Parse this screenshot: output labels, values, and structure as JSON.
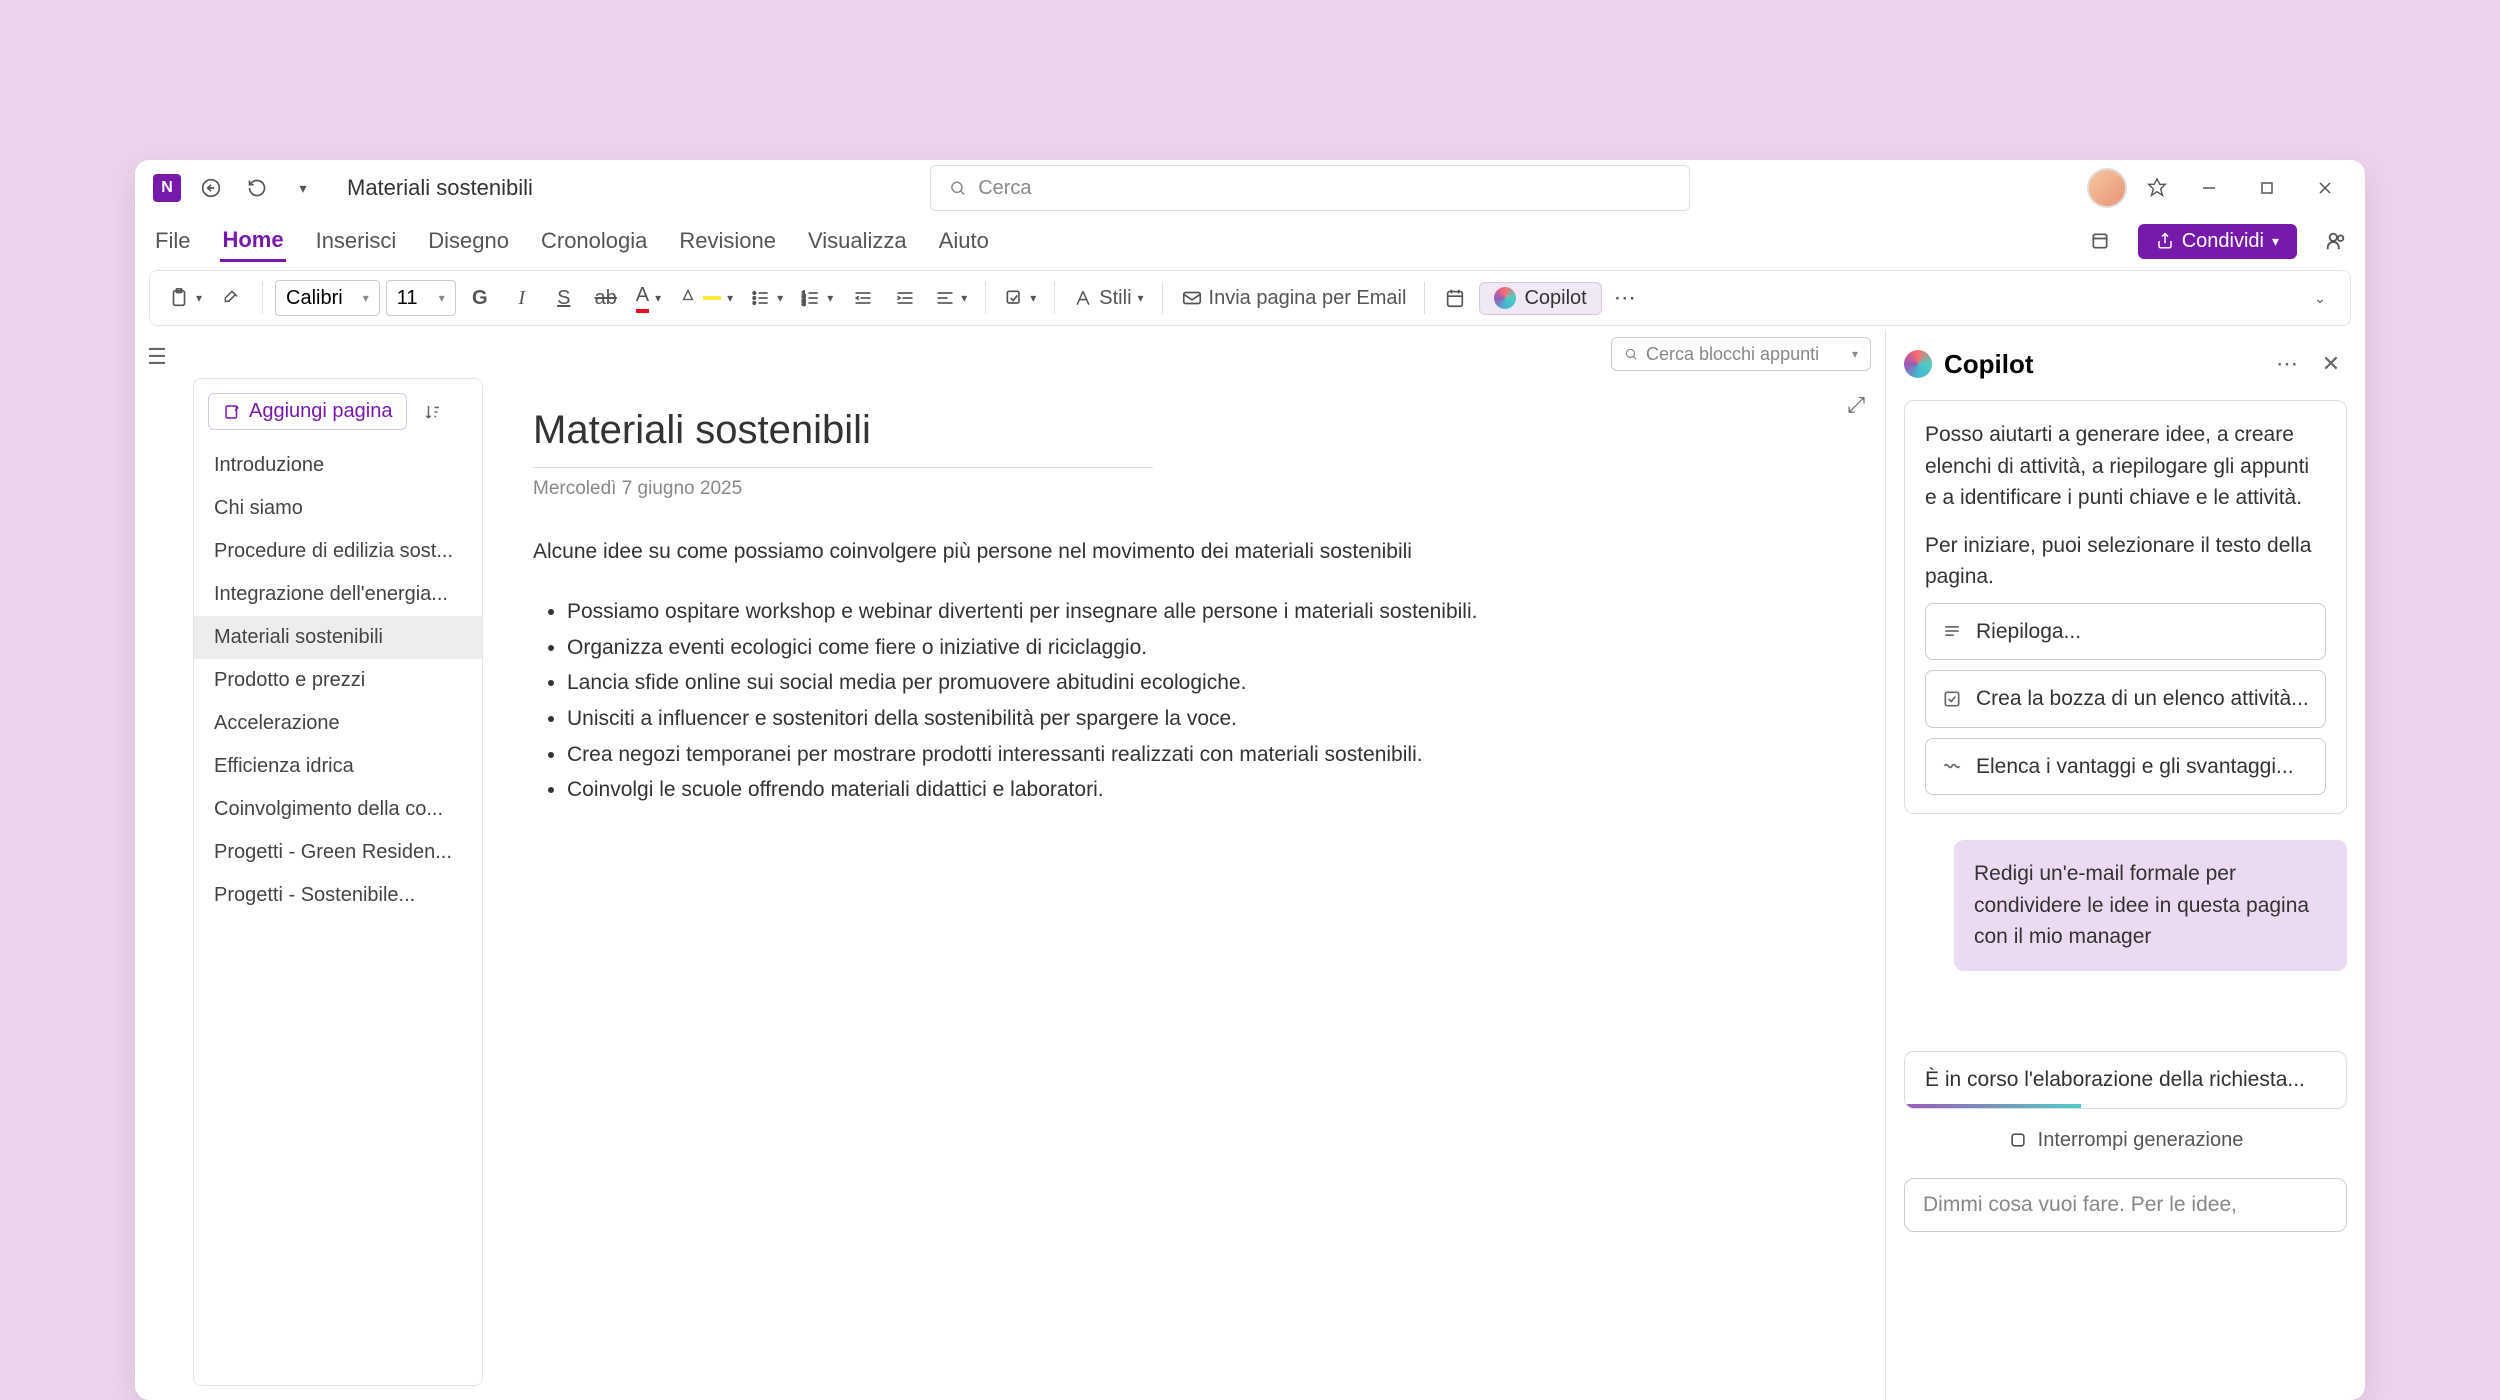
{
  "titlebar": {
    "doc_title": "Materiali sostenibili",
    "search_placeholder": "Cerca"
  },
  "menubar": {
    "tabs": [
      "File",
      "Home",
      "Inserisci",
      "Disegno",
      "Cronologia",
      "Revisione",
      "Visualizza",
      "Aiuto"
    ],
    "active": "Home",
    "share_label": "Condividi"
  },
  "toolbar": {
    "font_name": "Calibri",
    "font_size": "11",
    "styles_label": "Stili",
    "email_label": "Invia pagina per Email",
    "copilot_label": "Copilot"
  },
  "sub_search_placeholder": "Cerca blocchi appunti",
  "page_list": {
    "add_label": "Aggiungi pagina",
    "items": [
      "Introduzione",
      "Chi siamo",
      "Procedure di edilizia sost...",
      "Integrazione dell'energia...",
      "Materiali sostenibili",
      "Prodotto e prezzi",
      "Accelerazione",
      "Efficienza idrica",
      "Coinvolgimento della co...",
      "Progetti - Green Residen...",
      "Progetti - Sostenibile..."
    ],
    "active_index": 4
  },
  "editor": {
    "title": "Materiali sostenibili",
    "date": "Mercoledì 7 giugno 2025",
    "intro": "Alcune idee su come possiamo coinvolgere più persone nel movimento dei materiali sostenibili",
    "bullets": [
      "Possiamo ospitare workshop e webinar divertenti per insegnare alle persone i materiali sostenibili.",
      "Organizza eventi ecologici come fiere o iniziative di riciclaggio.",
      "Lancia sfide online sui social media per promuovere abitudini ecologiche.",
      "Unisciti a influencer e sostenitori della sostenibilità per spargere la voce.",
      "Crea negozi temporanei per mostrare prodotti interessanti realizzati con materiali sostenibili.",
      "Coinvolgi le scuole offrendo materiali didattici e laboratori."
    ]
  },
  "copilot": {
    "title": "Copilot",
    "intro1": "Posso aiutarti a generare idee, a creare elenchi di attività, a riepilogare gli appunti e a identificare i punti chiave e le attività.",
    "intro2": "Per iniziare, puoi selezionare il testo della pagina.",
    "suggestions": [
      "Riepiloga...",
      "Crea la bozza di un elenco attività...",
      "Elenca i vantaggi e gli svantaggi..."
    ],
    "user_message": "Redigi un'e-mail formale per condividere le idee in questa pagina con il mio manager",
    "status": "È in corso l'elaborazione della richiesta...",
    "stop_label": "Interrompi generazione",
    "input_placeholder": "Dimmi cosa vuoi fare. Per le idee,"
  }
}
